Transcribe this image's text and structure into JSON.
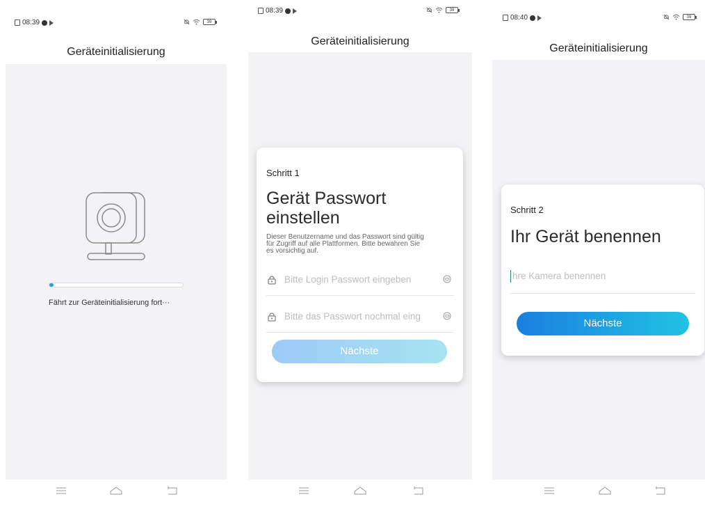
{
  "screens": [
    {
      "status": {
        "time": "08:39"
      },
      "title": "Geräteinitialisierung",
      "progress": {
        "value": 0.03,
        "label": "Fährt zur Geräteinitialisierung fort···"
      }
    },
    {
      "status": {
        "time": "08:39"
      },
      "title": "Geräteinitialisierung",
      "card": {
        "step": "Schritt 1",
        "heading_line1": "Gerät Passwort",
        "heading_line2": "einstellen",
        "description_line1": "Dieser Benutzername und das Passwort sind gültig",
        "description_line2": "für Zugriff auf alle Plattformen. Bitte bewahren Sie",
        "description_line3": "es vorsichtig auf.",
        "password_placeholder": "Bitte Login Passwort eingeben",
        "confirm_placeholder": "Bitte das Passwort nochmal eing",
        "next_label": "Nächste"
      }
    },
    {
      "status": {
        "time": "08:40"
      },
      "title": "Geräteinitialisierung",
      "card": {
        "step": "Schritt 2",
        "heading": "Ihr Gerät benennen",
        "name_placeholder": "hre Kamera benennen",
        "next_label": "Nächste"
      }
    }
  ],
  "status_icons": [
    "sim-icon",
    "notification-dot-icon",
    "cast-icon",
    "bell-off-icon",
    "wifi-icon",
    "battery-icon"
  ],
  "battery_label": "39",
  "colors": {
    "accent": "#1fa2d8",
    "button_gradient_start": "#1a7fe0",
    "button_gradient_end": "#20c3e2",
    "disabled_button_start": "#9ccbf6",
    "disabled_button_end": "#a6e3f1",
    "background": "#f3f3f5"
  }
}
